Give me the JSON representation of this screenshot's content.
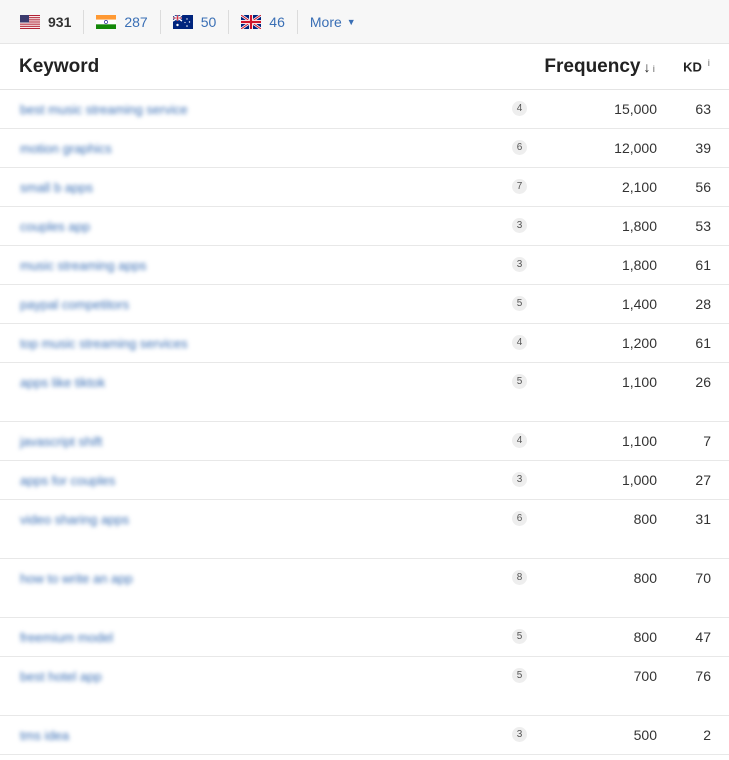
{
  "countries": [
    {
      "flag": "us-flag-icon",
      "count": "931",
      "active": true
    },
    {
      "flag": "india-flag-icon",
      "count": "287",
      "active": false
    },
    {
      "flag": "australia-flag-icon",
      "count": "50",
      "active": false
    },
    {
      "flag": "uk-flag-icon",
      "count": "46",
      "active": false
    }
  ],
  "more_label": "More",
  "table": {
    "headers": {
      "keyword": "Keyword",
      "frequency": "Frequency",
      "sort_indicator": "↓",
      "kd": "KD",
      "info": "i"
    },
    "rows": [
      {
        "keyword": "best music streaming service",
        "words": "4",
        "frequency": "15,000",
        "kd": "63",
        "tall": false
      },
      {
        "keyword": "motion graphics",
        "words": "6",
        "frequency": "12,000",
        "kd": "39",
        "tall": false
      },
      {
        "keyword": "small b apps",
        "words": "7",
        "frequency": "2,100",
        "kd": "56",
        "tall": false
      },
      {
        "keyword": "couples app",
        "words": "3",
        "frequency": "1,800",
        "kd": "53",
        "tall": false
      },
      {
        "keyword": "music streaming apps",
        "words": "3",
        "frequency": "1,800",
        "kd": "61",
        "tall": false
      },
      {
        "keyword": "paypal competitors",
        "words": "5",
        "frequency": "1,400",
        "kd": "28",
        "tall": false
      },
      {
        "keyword": "top music streaming services",
        "words": "4",
        "frequency": "1,200",
        "kd": "61",
        "tall": false
      },
      {
        "keyword": "apps like tiktok",
        "words": "5",
        "frequency": "1,100",
        "kd": "26",
        "tall": true
      },
      {
        "keyword": "javascript shift",
        "words": "4",
        "frequency": "1,100",
        "kd": "7",
        "tall": false
      },
      {
        "keyword": "apps for couples",
        "words": "3",
        "frequency": "1,000",
        "kd": "27",
        "tall": false
      },
      {
        "keyword": "video sharing apps",
        "words": "6",
        "frequency": "800",
        "kd": "31",
        "tall": true
      },
      {
        "keyword": "how to write an app",
        "words": "8",
        "frequency": "800",
        "kd": "70",
        "tall": true
      },
      {
        "keyword": "freemium model",
        "words": "5",
        "frequency": "800",
        "kd": "47",
        "tall": false
      },
      {
        "keyword": "best hotel app",
        "words": "5",
        "frequency": "700",
        "kd": "76",
        "tall": true
      },
      {
        "keyword": "tms idea",
        "words": "3",
        "frequency": "500",
        "kd": "2",
        "tall": false
      }
    ]
  }
}
